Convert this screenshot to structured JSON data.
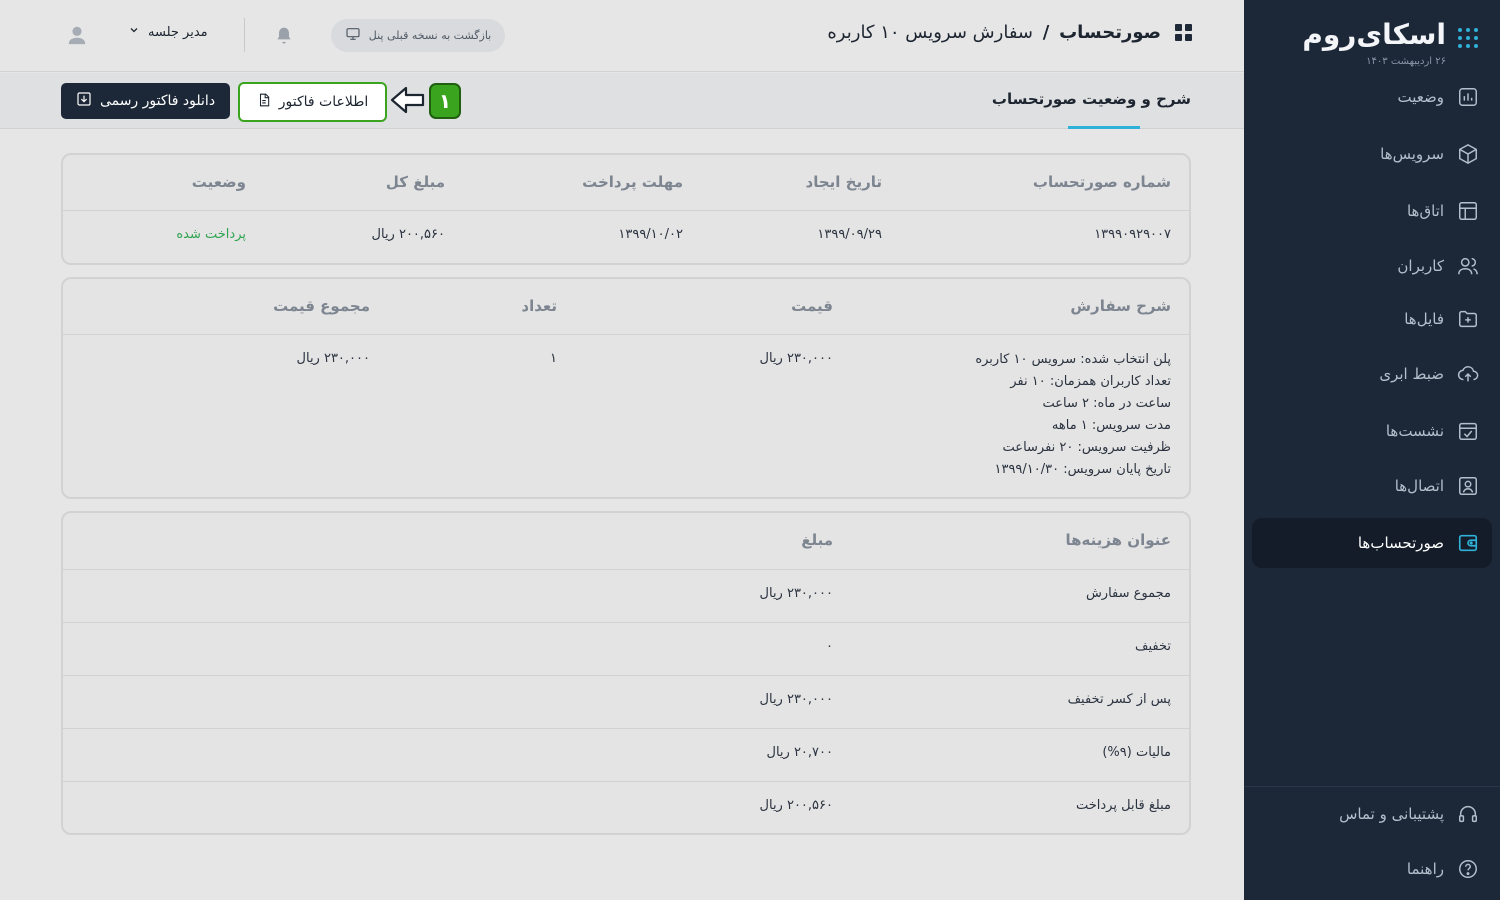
{
  "brand": {
    "name": "اسکای‌روم",
    "date": "۲۶ اردیبهشت ۱۴۰۳"
  },
  "sidebar": {
    "items": [
      {
        "label": "وضعیت",
        "icon": "chart-icon"
      },
      {
        "label": "سرویس‌ها",
        "icon": "box-icon"
      },
      {
        "label": "اتاق‌ها",
        "icon": "layout-icon"
      },
      {
        "label": "کاربران",
        "icon": "users-icon"
      },
      {
        "label": "فایل‌ها",
        "icon": "folder-plus-icon"
      },
      {
        "label": "ضبط ابری",
        "icon": "cloud-upload-icon"
      },
      {
        "label": "نشست‌ها",
        "icon": "calendar-check-icon"
      },
      {
        "label": "اتصال‌ها",
        "icon": "contact-icon"
      },
      {
        "label": "صورتحساب‌ها",
        "icon": "wallet-icon",
        "active": true
      }
    ],
    "bottom": [
      {
        "label": "پشتیبانی و تماس",
        "icon": "headset-icon"
      },
      {
        "label": "راهنما",
        "icon": "help-icon"
      }
    ]
  },
  "header": {
    "title_bold": "صورتحساب",
    "title_sep": "/",
    "title_rest": "سفارش سرویس ۱۰ کاربره",
    "back_label": "بازگشت به نسخه قبلی پنل",
    "user_label": "مدیر جلسه"
  },
  "subheader": {
    "tab_label": "شرح و وضعیت صورتحساب",
    "step_number": "۱",
    "info_button": "اطلاعات فاکتور",
    "download_button": "دانلود فاکتور رسمی"
  },
  "summary": {
    "headers": [
      "شماره صورتحساب",
      "تاریخ ایجاد",
      "مهلت پرداخت",
      "مبلغ کل",
      "وضعیت"
    ],
    "values": [
      "۱۳۹۹۰۹۲۹۰۰۷",
      "۱۳۹۹/۰۹/۲۹",
      "۱۳۹۹/۱۰/۰۲",
      "۲۰۰,۵۶۰ ریال",
      "پرداخت شده"
    ]
  },
  "order": {
    "headers": [
      "شرح سفارش",
      "قیمت",
      "تعداد",
      "مجموع قیمت"
    ],
    "description": [
      "پلن انتخاب شده: سرویس ۱۰ کاربره",
      "تعداد کاربران همزمان: ۱۰ نفر",
      "ساعت در ماه: ۲ ساعت",
      "مدت سرویس: ۱ ماهه",
      "ظرفیت سرویس: ۲۰ نفرساعت",
      "تاریخ پایان سرویس: ۱۳۹۹/۱۰/۳۰"
    ],
    "price": "۲۳۰,۰۰۰ ریال",
    "quantity": "۱",
    "total": "۲۳۰,۰۰۰ ریال"
  },
  "costs": {
    "headers": [
      "عنوان هزینه‌ها",
      "مبلغ"
    ],
    "rows": [
      {
        "title": "مجموع سفارش",
        "amount": "۲۳۰,۰۰۰ ریال"
      },
      {
        "title": "تخفیف",
        "amount": "۰"
      },
      {
        "title": "پس از کسر تخفیف",
        "amount": "۲۳۰,۰۰۰ ریال"
      },
      {
        "title": "مالیات (۹%)",
        "amount": "۲۰,۷۰۰ ریال"
      },
      {
        "title": "مبلغ قابل پرداخت",
        "amount": "۲۰۰,۵۶۰ ریال"
      }
    ]
  },
  "colors": {
    "sidebar_bg": "#1c2838",
    "accent": "#2fb1d8",
    "highlight_green": "#3aa41f",
    "paid_green": "#2ea44f"
  }
}
